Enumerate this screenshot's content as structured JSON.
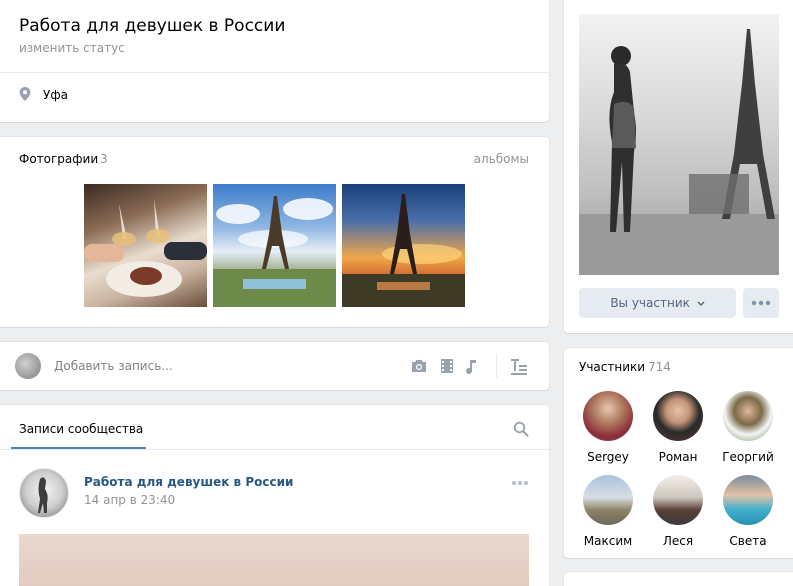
{
  "header": {
    "title": "Работа для девушек в России",
    "status_link": "изменить статус",
    "location": "Уфа"
  },
  "photos": {
    "title": "Фотографии",
    "count": "3",
    "albums_link": "альбомы"
  },
  "post_box": {
    "placeholder": "Добавить запись..."
  },
  "feed": {
    "tab_label": "Записи сообщества",
    "post": {
      "author": "Работа для девушек в России",
      "date": "14 апр в 23:40"
    }
  },
  "cover": {
    "member_button": "Вы участник"
  },
  "members": {
    "title": "Участники",
    "count": "714",
    "items": [
      {
        "name": "Sergey"
      },
      {
        "name": "Роман"
      },
      {
        "name": "Георгий"
      },
      {
        "name": "Максим"
      },
      {
        "name": "Леся"
      },
      {
        "name": "Света"
      }
    ]
  },
  "colors": {
    "background": "#edeef0",
    "link": "#2a5885",
    "accent": "#5181b8",
    "button": "#e5ebf1",
    "muted": "#939393"
  }
}
